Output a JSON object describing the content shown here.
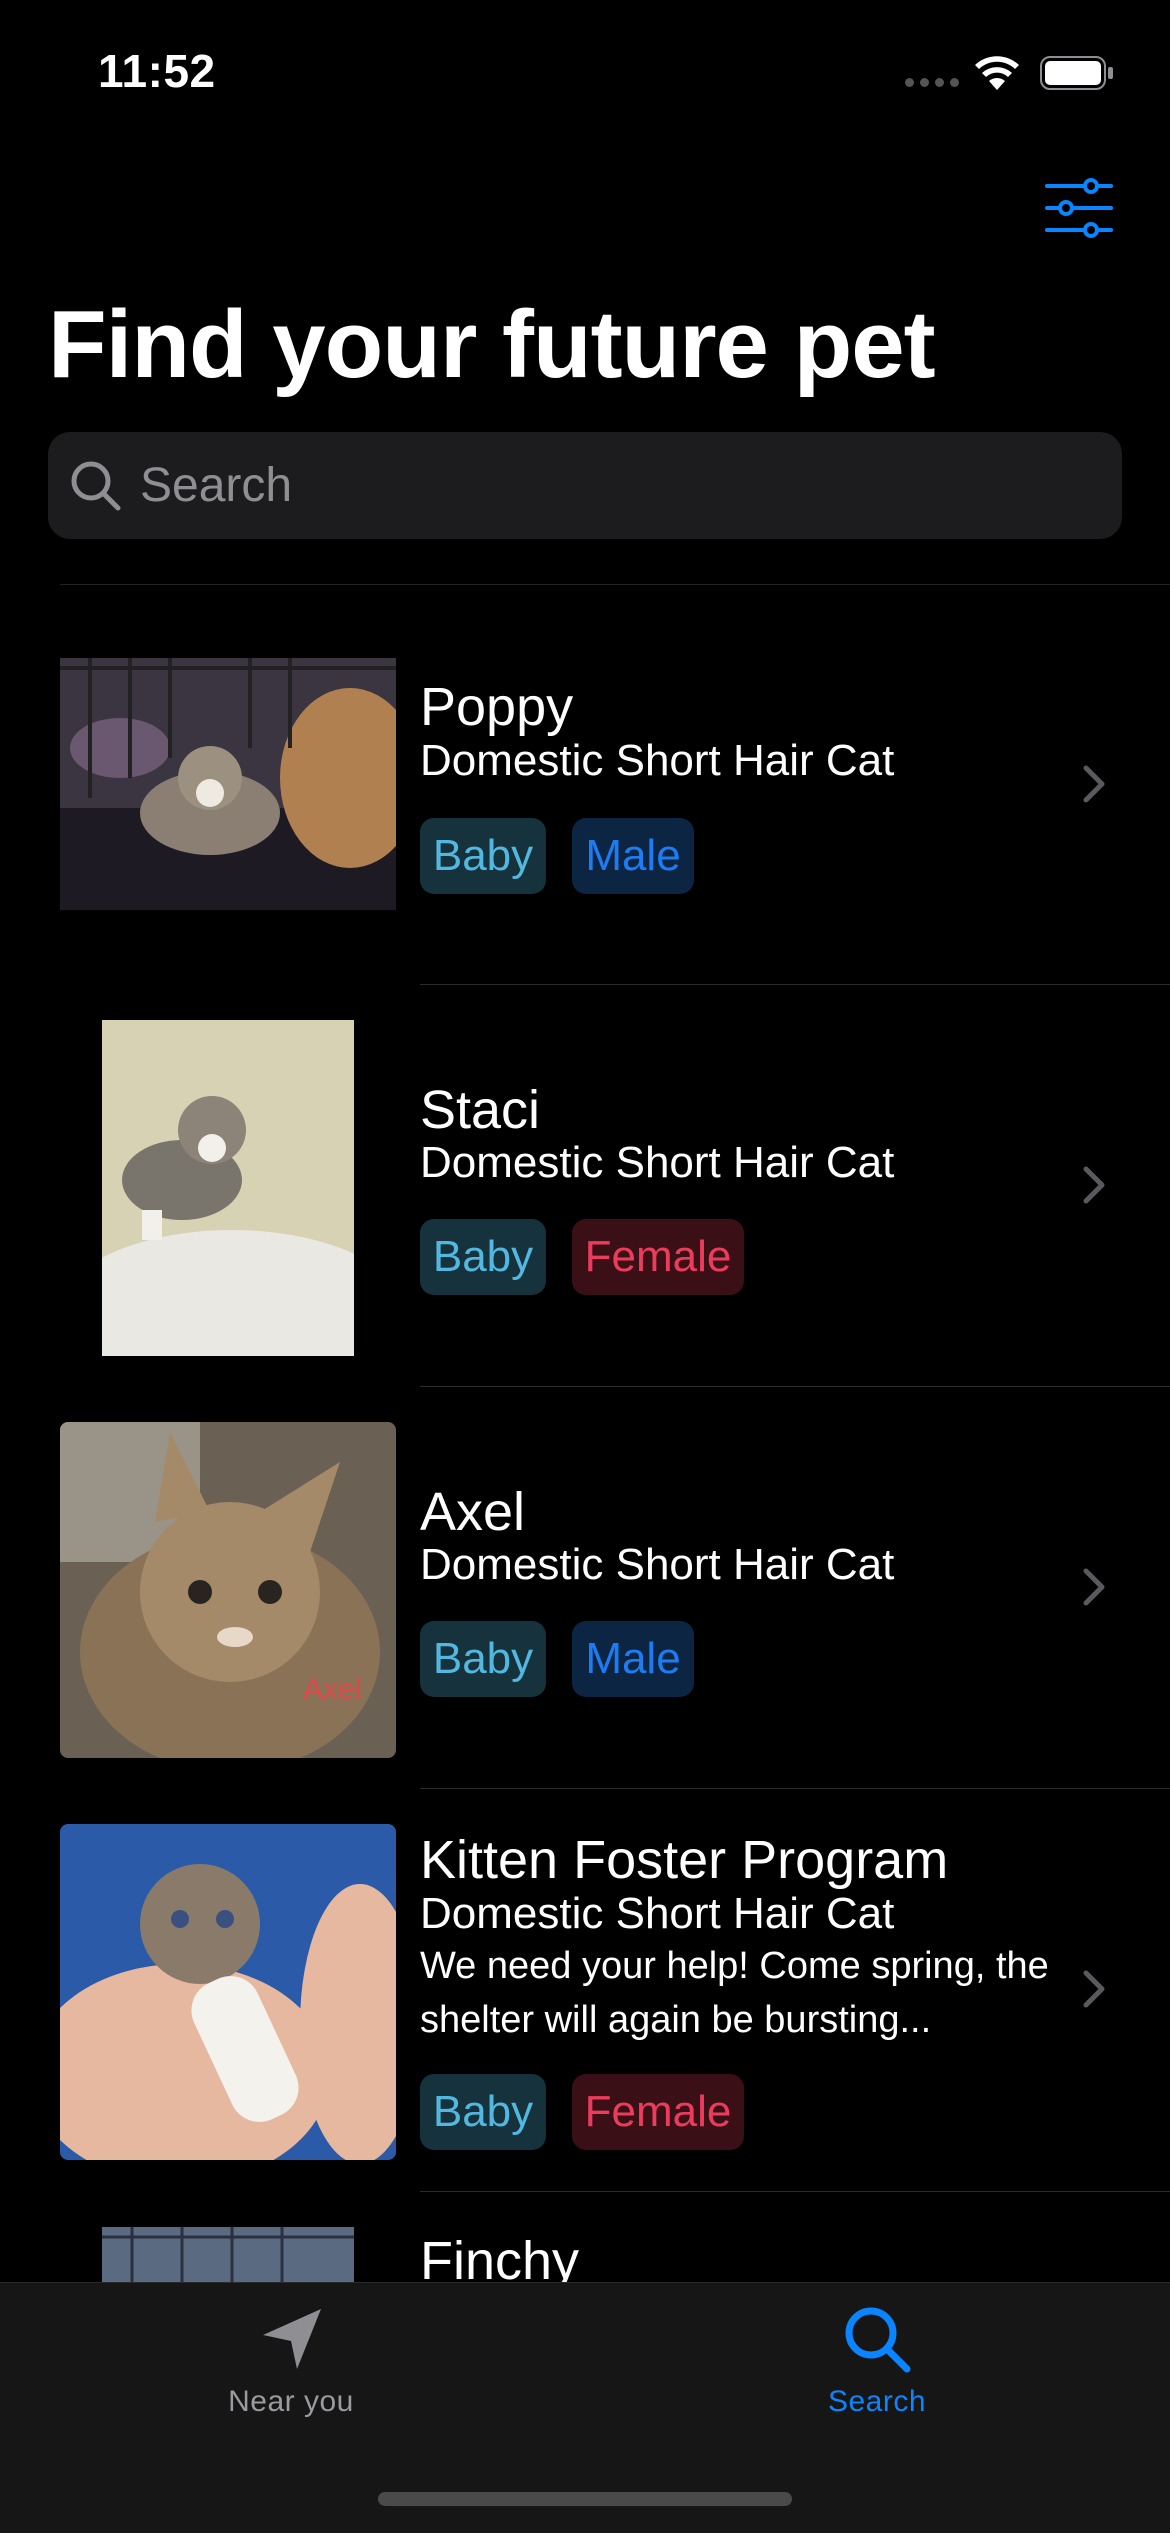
{
  "status_bar": {
    "time": "11:52"
  },
  "header": {
    "title": "Find your future pet"
  },
  "search": {
    "placeholder": "Search"
  },
  "pets": [
    {
      "name": "Poppy",
      "breed": "Domestic Short Hair Cat",
      "description": "",
      "age": "Baby",
      "gender": "Male"
    },
    {
      "name": "Staci",
      "breed": "Domestic Short Hair Cat",
      "description": "",
      "age": "Baby",
      "gender": "Female"
    },
    {
      "name": "Axel",
      "breed": "Domestic Short Hair Cat",
      "description": "",
      "age": "Baby",
      "gender": "Male",
      "photo_caption": "Axel"
    },
    {
      "name": "Kitten Foster Program",
      "breed": "Domestic Short Hair Cat",
      "description": "We need your help!  Come spring, the shelter will again be bursting...",
      "age": "Baby",
      "gender": "Female"
    },
    {
      "name": "Finchy"
    }
  ],
  "tab_bar": {
    "items": [
      {
        "label": "Near you",
        "icon": "location-arrow-icon",
        "selected": false
      },
      {
        "label": "Search",
        "icon": "magnifying-glass-icon",
        "selected": true
      }
    ]
  },
  "colors": {
    "accent": "#0a84ff",
    "baby_tag_text": "#52b8e0",
    "male_tag_text": "#1d7cf3",
    "female_tag_text": "#ec3c5c"
  }
}
